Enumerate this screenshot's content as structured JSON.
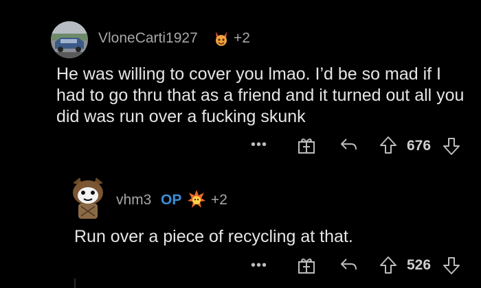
{
  "comments": [
    {
      "username": "VloneCarti1927",
      "award_count": "+2",
      "body": "He was willing to cover you lmao. I’d be so mad if I had to go thru that as a friend and it turned out all you did was run over a fucking skunk",
      "score": "676",
      "icons": [
        "more-icon",
        "gift-icon",
        "reply-icon",
        "upvote-icon",
        "downvote-icon"
      ]
    },
    {
      "username": "vhm3",
      "op_badge": "OP",
      "award_count": "+2",
      "body": "Run over a piece of recycling at that.",
      "score": "526",
      "icons": [
        "more-icon",
        "gift-icon",
        "reply-icon",
        "upvote-icon",
        "downvote-icon"
      ]
    }
  ],
  "colors": {
    "background": "#000000",
    "username": "#a7a7a7",
    "body_text": "#e6e6e6",
    "op_badge": "#3b8fd9"
  }
}
